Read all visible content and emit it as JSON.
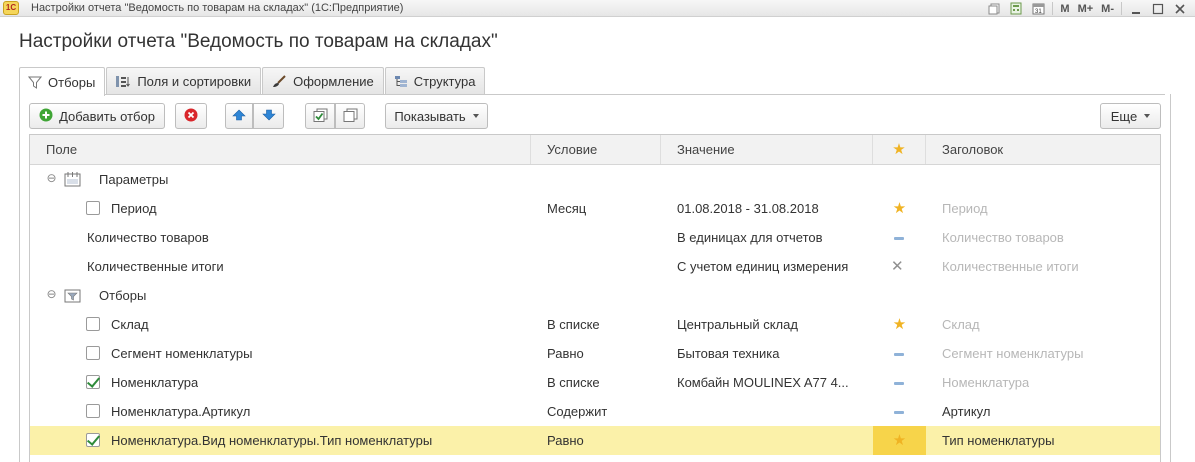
{
  "window": {
    "title": "Настройки отчета \"Ведомость по товарам на складах\"  (1С:Предприятие)",
    "logo_text": "1С",
    "tools": [
      "M",
      "M+",
      "M-"
    ]
  },
  "form": {
    "title": "Настройки отчета \"Ведомость по товарам на складах\""
  },
  "tabs": [
    {
      "label": "Отборы",
      "icon": "filter-icon",
      "active": true
    },
    {
      "label": "Поля и сортировки",
      "icon": "fields-icon",
      "active": false
    },
    {
      "label": "Оформление",
      "icon": "brush-icon",
      "active": false
    },
    {
      "label": "Структура",
      "icon": "structure-icon",
      "active": false
    }
  ],
  "toolbar": {
    "add_filter": "Добавить отбор",
    "show": "Показывать",
    "more": "Еще"
  },
  "grid": {
    "columns": [
      "Поле",
      "Условие",
      "Значение",
      "★",
      "Заголовок"
    ],
    "rows": [
      {
        "type": "group",
        "field": "Параметры",
        "icon": "parameters-icon"
      },
      {
        "type": "item",
        "checkbox": false,
        "field": "Период",
        "condition": "Месяц",
        "value": "01.08.2018 - 31.08.2018",
        "use": "star",
        "title": "Период",
        "title_muted": true
      },
      {
        "type": "plain",
        "field": "Количество товаров",
        "condition": "",
        "value": "В единицах для отчетов",
        "use": "dash",
        "title": "Количество товаров",
        "title_muted": true
      },
      {
        "type": "plain",
        "field": "Количественные итоги",
        "condition": "",
        "value": "С учетом единиц измерения",
        "use": "x",
        "title": "Количественные итоги",
        "title_muted": true
      },
      {
        "type": "group",
        "field": "Отборы",
        "icon": "filters-group-icon"
      },
      {
        "type": "item",
        "checkbox": false,
        "field": "Склад",
        "condition": "В списке",
        "value": "Центральный склад",
        "use": "star",
        "title": "Склад",
        "title_muted": true
      },
      {
        "type": "item",
        "checkbox": false,
        "field": "Сегмент номенклатуры",
        "condition": "Равно",
        "value": "Бытовая техника",
        "use": "dash",
        "title": "Сегмент номенклатуры",
        "title_muted": true
      },
      {
        "type": "item",
        "checkbox": true,
        "field": "Номенклатура",
        "condition": "В списке",
        "value": "Комбайн MOULINEX  A77 4...",
        "use": "dash",
        "title": "Номенклатура",
        "title_muted": true
      },
      {
        "type": "item",
        "checkbox": false,
        "field": "Номенклатура.Артикул",
        "condition": "Содержит",
        "value": "",
        "use": "dash",
        "title": "Артикул",
        "title_muted": false
      },
      {
        "type": "item",
        "checkbox": true,
        "field": "Номенклатура.Вид номенклатуры.Тип номенклатуры",
        "condition": "Равно",
        "value": "",
        "use": "star",
        "title": "Тип номенклатуры",
        "title_muted": false,
        "selected": true
      }
    ]
  },
  "colors": {
    "accent_star": "#f0b323",
    "selected_row": "#fbf1a9",
    "selected_use_cell": "#f7d44a"
  }
}
